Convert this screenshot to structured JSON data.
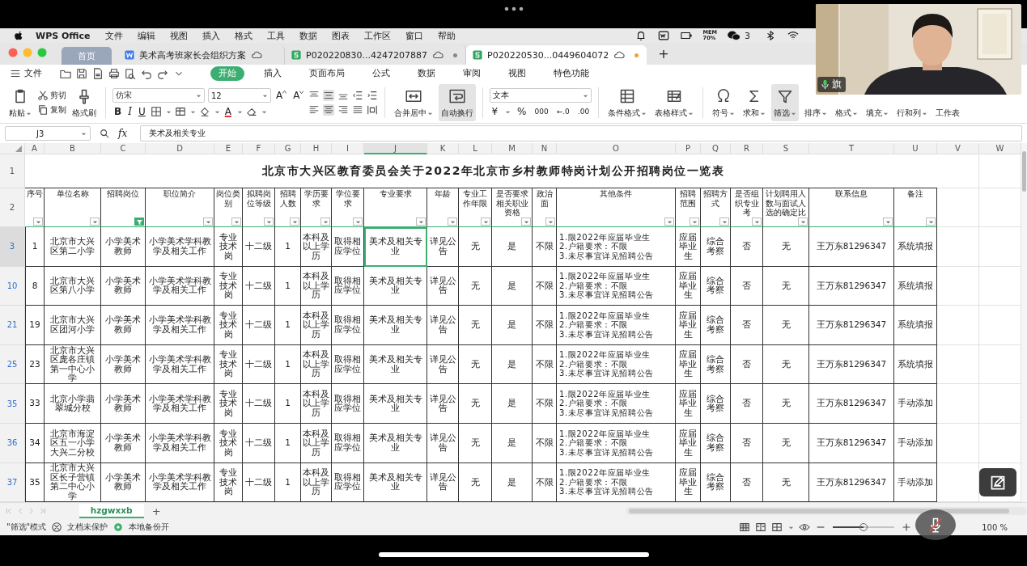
{
  "menu_bar": {
    "app": "WPS Office",
    "items": [
      "文件",
      "编辑",
      "视图",
      "插入",
      "格式",
      "工具",
      "数据",
      "图表",
      "工作区",
      "窗口",
      "帮助"
    ],
    "mem_label": "MEM",
    "mem_value": "70%",
    "wechat_count": "3"
  },
  "tabs": [
    {
      "label": "首页",
      "kind": "home",
      "selected": false
    },
    {
      "label": "美术高考班家长会组织方案",
      "kind": "writer",
      "selected": false,
      "unsaved": false
    },
    {
      "label": "P020220830...4247207887",
      "kind": "sheet",
      "selected": false,
      "unsaved": true
    },
    {
      "label": "P020220530...0449604072",
      "kind": "sheet",
      "selected": true,
      "unsaved": true
    }
  ],
  "new_tab": "+",
  "ribbon": {
    "file": "文件",
    "tabs": [
      {
        "label": "开始",
        "selected": true
      },
      {
        "label": "插入",
        "selected": false
      },
      {
        "label": "页面布局",
        "selected": false
      },
      {
        "label": "公式",
        "selected": false
      },
      {
        "label": "数据",
        "selected": false
      },
      {
        "label": "审阅",
        "selected": false
      },
      {
        "label": "视图",
        "selected": false
      },
      {
        "label": "特色功能",
        "selected": false
      }
    ]
  },
  "toolbar": {
    "paste": "粘贴",
    "cut": "剪切",
    "copy": "复制",
    "format_painter": "格式刷",
    "font": "仿宋",
    "font_size": "12",
    "grow": "A",
    "shrink": "A",
    "bold": "B",
    "italic": "I",
    "underline": "U",
    "font_color": "A",
    "align_vertical": [
      {
        "selected": false
      },
      {
        "selected": true
      },
      {
        "selected": false
      }
    ],
    "align_horizontal": [
      {
        "selected": false
      },
      {
        "selected": true
      },
      {
        "selected": false
      },
      {
        "selected": false
      }
    ],
    "merge": "合并居中",
    "wrap": {
      "label": "自动换行",
      "selected": true
    },
    "number_format": "文本",
    "currency": "¥",
    "percent": "%",
    "thousands": "000",
    "decimals_more": "←.0",
    "decimals_less": ".00",
    "conditional": "条件格式",
    "table_style": "表格样式",
    "symbol": "符号",
    "sum": "求和",
    "filter": {
      "label": "筛选",
      "selected": true
    },
    "sort": "排序",
    "format": "格式",
    "fill": "填充",
    "rows_cols": "行和列",
    "worksheet": "工作表"
  },
  "formula_bar": {
    "cell": "J3",
    "fx": "fx",
    "value": "美术及相关专业"
  },
  "sheet": {
    "columns": [
      {
        "letter": "A",
        "selected": false
      },
      {
        "letter": "B",
        "selected": false
      },
      {
        "letter": "C",
        "selected": false
      },
      {
        "letter": "D",
        "selected": false
      },
      {
        "letter": "E",
        "selected": false
      },
      {
        "letter": "F",
        "selected": false
      },
      {
        "letter": "G",
        "selected": false
      },
      {
        "letter": "H",
        "selected": false
      },
      {
        "letter": "I",
        "selected": false
      },
      {
        "letter": "J",
        "selected": true
      },
      {
        "letter": "K",
        "selected": false
      },
      {
        "letter": "L",
        "selected": false
      },
      {
        "letter": "M",
        "selected": false
      },
      {
        "letter": "N",
        "selected": false
      },
      {
        "letter": "O",
        "selected": false
      },
      {
        "letter": "P",
        "selected": false
      },
      {
        "letter": "Q",
        "selected": false
      },
      {
        "letter": "R",
        "selected": false
      },
      {
        "letter": "S",
        "selected": false
      },
      {
        "letter": "T",
        "selected": false
      },
      {
        "letter": "U",
        "selected": false
      },
      {
        "letter": "V",
        "selected": false
      },
      {
        "letter": "W",
        "selected": false
      }
    ],
    "title": {
      "number": "1",
      "text": "北京市大兴区教育委员会关于2022年北京市乡村教师特岗计划公开招聘岗位一览表"
    },
    "header": {
      "number": "2",
      "headers": [
        {
          "text": "序号",
          "filter_active": false
        },
        {
          "text": "单位名称",
          "filter_active": false
        },
        {
          "text": "招聘岗位",
          "filter_active": true
        },
        {
          "text": "职位简介",
          "filter_active": false
        },
        {
          "text": "岗位类别",
          "filter_active": false
        },
        {
          "text": "拟聘岗位等级",
          "filter_active": false
        },
        {
          "text": "招聘人数",
          "filter_active": false
        },
        {
          "text": "学历要求",
          "filter_active": false
        },
        {
          "text": "学位要求",
          "filter_active": false
        },
        {
          "text": "专业要求",
          "filter_active": false
        },
        {
          "text": "年龄",
          "filter_active": false
        },
        {
          "text": "专业工作年限",
          "filter_active": false
        },
        {
          "text": "是否要求相关职业资格",
          "filter_active": false
        },
        {
          "text": "政治面",
          "filter_active": false
        },
        {
          "text": "其他条件",
          "filter_active": false
        },
        {
          "text": "招聘范围",
          "filter_active": false
        },
        {
          "text": "招聘方式",
          "filter_active": false
        },
        {
          "text": "是否组织专业考",
          "filter_active": false
        },
        {
          "text": "计划聘用人数与面试人选的确定比",
          "filter_active": false
        },
        {
          "text": "联系信息",
          "filter_active": false
        },
        {
          "text": "备注",
          "filter_active": false
        }
      ]
    },
    "rows": [
      {
        "number": "3",
        "selected": true,
        "cells": [
          "1",
          "北京市大兴区第二小学",
          "小学美术教师",
          "小学美术学科教学及相关工作",
          "专业技术岗",
          "十二级",
          "1",
          "本科及以上学历",
          "取得相应学位",
          "美术及相关专业",
          "详见公告",
          "无",
          "是",
          "不限",
          "1.限2022年应届毕业生\n2.户籍要求：不限\n3.未尽事宜详见招聘公告",
          "应届毕业生",
          "综合考察",
          "否",
          "无",
          "王万东81296347",
          "系统填报"
        ]
      },
      {
        "number": "10",
        "selected": false,
        "cells": [
          "8",
          "北京市大兴区第八小学",
          "小学美术教师",
          "小学美术学科教学及相关工作",
          "专业技术岗",
          "十二级",
          "1",
          "本科及以上学历",
          "取得相应学位",
          "美术及相关专业",
          "详见公告",
          "无",
          "是",
          "不限",
          "1.限2022年应届毕业生\n2.户籍要求：不限\n3.未尽事宜详见招聘公告",
          "应届毕业生",
          "综合考察",
          "否",
          "无",
          "王万东81296347",
          "系统填报"
        ]
      },
      {
        "number": "21",
        "selected": false,
        "cells": [
          "19",
          "北京市大兴区团河小学",
          "小学美术教师",
          "小学美术学科教学及相关工作",
          "专业技术岗",
          "十二级",
          "1",
          "本科及以上学历",
          "取得相应学位",
          "美术及相关专业",
          "详见公告",
          "无",
          "是",
          "不限",
          "1.限2022年应届毕业生\n2.户籍要求：不限\n3.未尽事宜详见招聘公告",
          "应届毕业生",
          "综合考察",
          "否",
          "无",
          "王万东81296347",
          "系统填报"
        ]
      },
      {
        "number": "25",
        "selected": false,
        "cells": [
          "23",
          "北京市大兴区庞各庄镇第一中心小学",
          "小学美术教师",
          "小学美术学科教学及相关工作",
          "专业技术岗",
          "十二级",
          "1",
          "本科及以上学历",
          "取得相应学位",
          "美术及相关专业",
          "详见公告",
          "无",
          "是",
          "不限",
          "1.限2022年应届毕业生\n2.户籍要求：不限\n3.未尽事宜详见招聘公告",
          "应届毕业生",
          "综合考察",
          "否",
          "无",
          "王万东81296347",
          "系统填报"
        ]
      },
      {
        "number": "35",
        "selected": false,
        "cells": [
          "33",
          "北京小学翡翠城分校",
          "小学美术教师",
          "小学美术学科教学及相关工作",
          "专业技术岗",
          "十二级",
          "1",
          "本科及以上学历",
          "取得相应学位",
          "美术及相关专业",
          "详见公告",
          "无",
          "是",
          "不限",
          "1.限2022年应届毕业生\n2.户籍要求：不限\n3.未尽事宜详见招聘公告",
          "应届毕业生",
          "综合考察",
          "否",
          "无",
          "王万东81296347",
          "手动添加"
        ]
      },
      {
        "number": "36",
        "selected": false,
        "cells": [
          "34",
          "北京市海淀区五一小学大兴二分校",
          "小学美术教师",
          "小学美术学科教学及相关工作",
          "专业技术岗",
          "十二级",
          "1",
          "本科及以上学历",
          "取得相应学位",
          "美术及相关专业",
          "详见公告",
          "无",
          "是",
          "不限",
          "1.限2022年应届毕业生\n2.户籍要求：不限\n3.未尽事宜详见招聘公告",
          "应届毕业生",
          "综合考察",
          "否",
          "无",
          "王万东81296347",
          "手动添加"
        ]
      },
      {
        "number": "37",
        "selected": false,
        "cells": [
          "35",
          "北京市大兴区长子营镇第二中心小学",
          "小学美术教师",
          "小学美术学科教学及相关工作",
          "专业技术岗",
          "十二级",
          "1",
          "本科及以上学历",
          "取得相应学位",
          "美术及相关专业",
          "详见公告",
          "无",
          "是",
          "不限",
          "1.限2022年应届毕业生\n2.户籍要求：不限\n3.未尽事宜详见招聘公告",
          "应届毕业生",
          "综合考察",
          "否",
          "无",
          "王万东81296347",
          "手动添加"
        ]
      }
    ]
  },
  "sheet_tabs": {
    "tabs": [
      {
        "label": "hzgwxxb",
        "selected": true
      }
    ],
    "add": "+"
  },
  "status_bar": {
    "mode": "\"筛选\"模式",
    "protection": "文档未保护",
    "backup": "本地备份开",
    "backup_on": true,
    "zoom": {
      "level": 0.5,
      "text": "100 %"
    }
  },
  "video": {
    "name": "旗",
    "mic_on": true
  }
}
